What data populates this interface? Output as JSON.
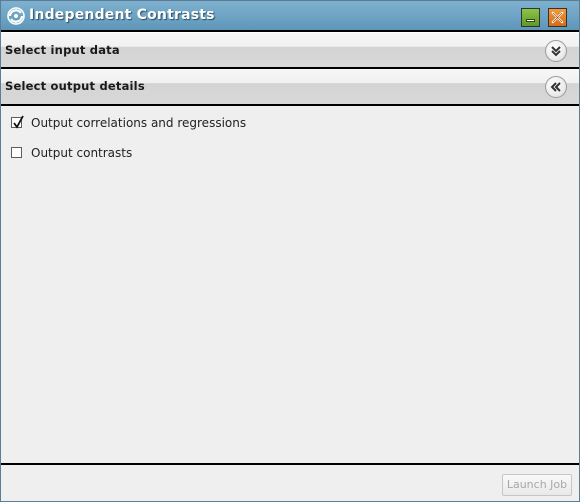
{
  "window": {
    "title": "Independent Contrasts",
    "icon": "app-swirl-icon",
    "minimize_icon": "minimize-icon",
    "close_icon": "close-icon",
    "colors": {
      "titlebar": "#6ea4c4",
      "minimize": "#6fab31",
      "close": "#e67a22"
    }
  },
  "sections": [
    {
      "title": "Select input data",
      "state": "collapsed",
      "toggle_icon": "chevron-double-down-icon"
    },
    {
      "title": "Select output details",
      "state": "expanded",
      "toggle_icon": "chevron-double-left-icon"
    }
  ],
  "output_options": [
    {
      "label": "Output correlations and regressions",
      "checked": true
    },
    {
      "label": "Output contrasts",
      "checked": false
    }
  ],
  "footer": {
    "launch_label": "Launch Job",
    "launch_enabled": false
  }
}
